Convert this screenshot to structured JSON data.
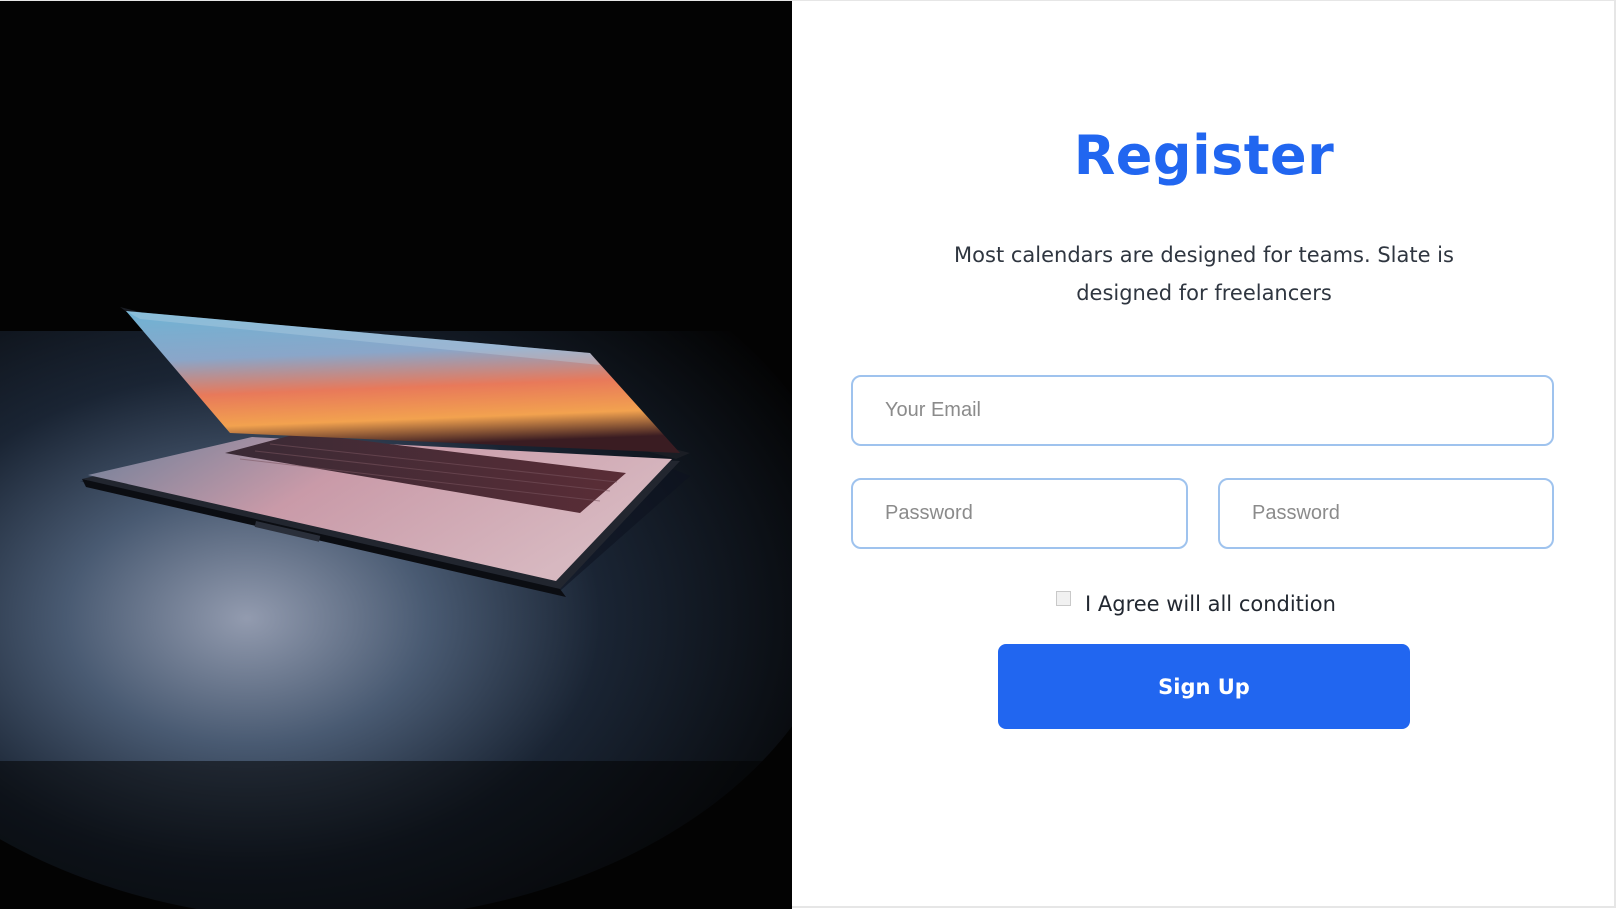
{
  "hero": {
    "image": "laptop-photo"
  },
  "form": {
    "title": "Register",
    "subtitle": "Most calendars are designed for teams. Slate is designed for freelancers",
    "email_placeholder": "Your Email",
    "password_placeholder": "Password",
    "confirm_password_placeholder": "Password",
    "agree_label": "I Agree will all condition",
    "agree_checked": false,
    "submit_label": "Sign Up"
  },
  "colors": {
    "accent": "#2166f0",
    "field_border": "#9fc3ee",
    "text": "#2f3640"
  }
}
